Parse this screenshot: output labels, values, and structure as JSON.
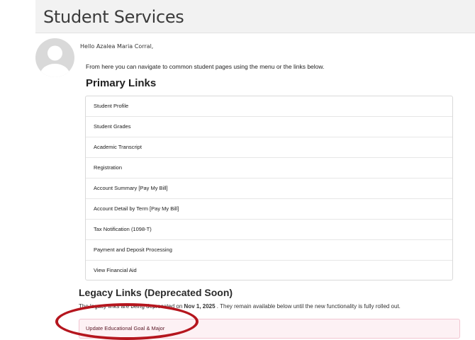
{
  "page": {
    "title": "Student Services"
  },
  "greeting": "Hello Azalea Maria Corral,",
  "intro": "From here you can navigate to common student pages using the menu or the links below.",
  "primary": {
    "title": "Primary Links",
    "links": [
      "Student Profile",
      "Student Grades",
      "Academic Transcript",
      "Registration",
      "Account Summary [Pay My Bill]",
      "Account Detail by Term [Pay My Bill]",
      "Tax Notification (1098-T)",
      "Payment and Deposit Processing",
      "View Financial Aid"
    ]
  },
  "legacy": {
    "title": "Legacy Links (Deprecated Soon)",
    "note_before": "The legacy links are being deprecated on ",
    "note_date": "Nov 1, 2025",
    "note_after": " . They remain available below until the new functionality is fully rolled out.",
    "links": [
      "Update Educational Goal & Major"
    ]
  },
  "colors": {
    "annotation": "#b5161e",
    "legacy_bg": "#fdf1f4",
    "header_bg": "#f2f2f2"
  },
  "icons": {
    "avatar": "user-silhouette-icon"
  }
}
